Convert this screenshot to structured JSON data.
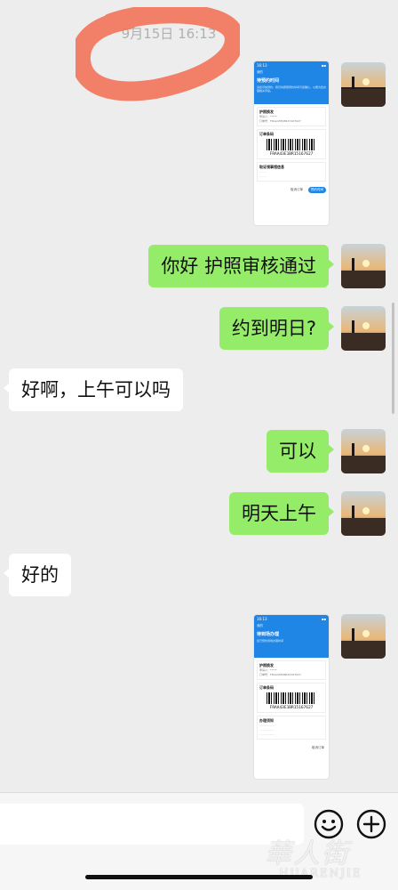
{
  "chat": {
    "timestamp": "9月15日 16:13",
    "messages": [
      {
        "side": "out",
        "text": "你好 护照审核通过"
      },
      {
        "side": "out",
        "text": "约到明日?"
      },
      {
        "side": "in",
        "text": "好啊，上午可以吗"
      },
      {
        "side": "out",
        "text": "可以"
      },
      {
        "side": "out",
        "text": "明天上午"
      },
      {
        "side": "in",
        "text": "好的"
      }
    ]
  },
  "screenshot1": {
    "time": "16:13",
    "back": "我的",
    "title": "待预约时间",
    "desc": "请您尽快预约，我们将按照预约时间与您确认，以便为您办理相关手续。",
    "card_label": "护照换发",
    "card_line1": "申请人：*****",
    "card_line2": "订单号：FRAA43E1BR15167627",
    "section_label": "订单条码",
    "barcode_text": "FRAA43E1BR15167627",
    "section2_label": "取证领事馆信息",
    "btn_secondary": "取消订单",
    "btn_primary": "预约时间"
  },
  "screenshot2": {
    "time": "16:13",
    "back": "我的",
    "title": "待到场办理",
    "desc": "您已预约到场办理时间",
    "card_label": "护照换发",
    "card_line1": "申请人：*****",
    "card_line2": "订单号：FRAA43E1BR15167627",
    "section_label": "订单条码",
    "barcode_text": "FRAA43E1BR15167627",
    "section2_label": "办理须知",
    "btn_secondary": "取消订单"
  },
  "input": {
    "placeholder": ""
  },
  "icons": {
    "emoji": "emoji-face-icon",
    "plus": "plus-icon"
  },
  "watermark": {
    "cn": "華人街",
    "en": "HUARENJIE"
  },
  "colors": {
    "out_bubble": "#95ec69",
    "in_bubble": "#ffffff",
    "background": "#ededed",
    "accent": "#1f86e6",
    "highlight": "#f26b4f"
  }
}
